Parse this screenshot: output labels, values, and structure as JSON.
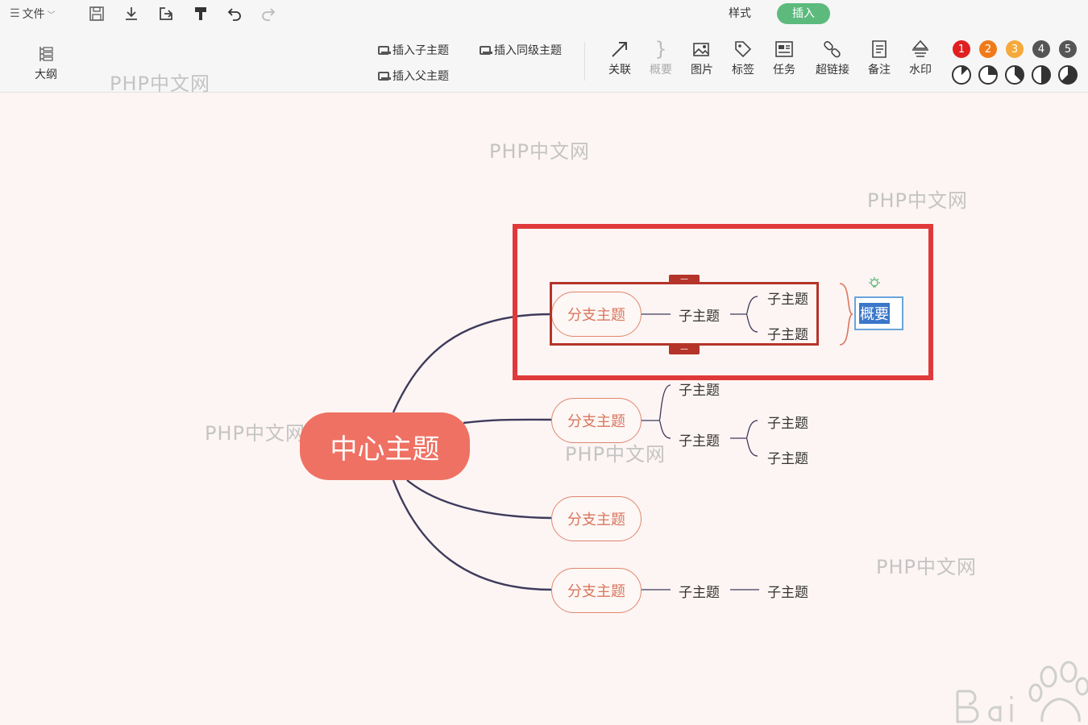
{
  "topbar": {
    "file_label": "文件",
    "tabs": [
      {
        "label": "样式"
      },
      {
        "label": "插入"
      }
    ]
  },
  "ribbon": {
    "outline_label": "大纲",
    "insert_child": "插入子主题",
    "insert_sibling": "插入同级主题",
    "insert_parent": "插入父主题",
    "tools": [
      {
        "label": "关联",
        "icon": "arrow-icon"
      },
      {
        "label": "概要",
        "icon": "brace-icon"
      },
      {
        "label": "图片",
        "icon": "image-icon"
      },
      {
        "label": "标签",
        "icon": "tag-icon"
      },
      {
        "label": "任务",
        "icon": "task-icon"
      },
      {
        "label": "超链接",
        "icon": "link-icon"
      },
      {
        "label": "备注",
        "icon": "note-icon"
      },
      {
        "label": "水印",
        "icon": "watermark-icon"
      }
    ],
    "priorities": [
      {
        "label": "1",
        "color": "#e02020"
      },
      {
        "label": "2",
        "color": "#f07a1a"
      },
      {
        "label": "3",
        "color": "#f5a93a"
      },
      {
        "label": "4",
        "color": "#555555"
      },
      {
        "label": "5",
        "color": "#555555"
      }
    ],
    "progress_levels": [
      0.125,
      0.25,
      0.375,
      0.5,
      0.625
    ]
  },
  "watermark_text": "PHP中文网",
  "mindmap": {
    "center": "中心主题",
    "branch_label": "分支主题",
    "sub_label": "子主题",
    "summary_value": "概要"
  }
}
